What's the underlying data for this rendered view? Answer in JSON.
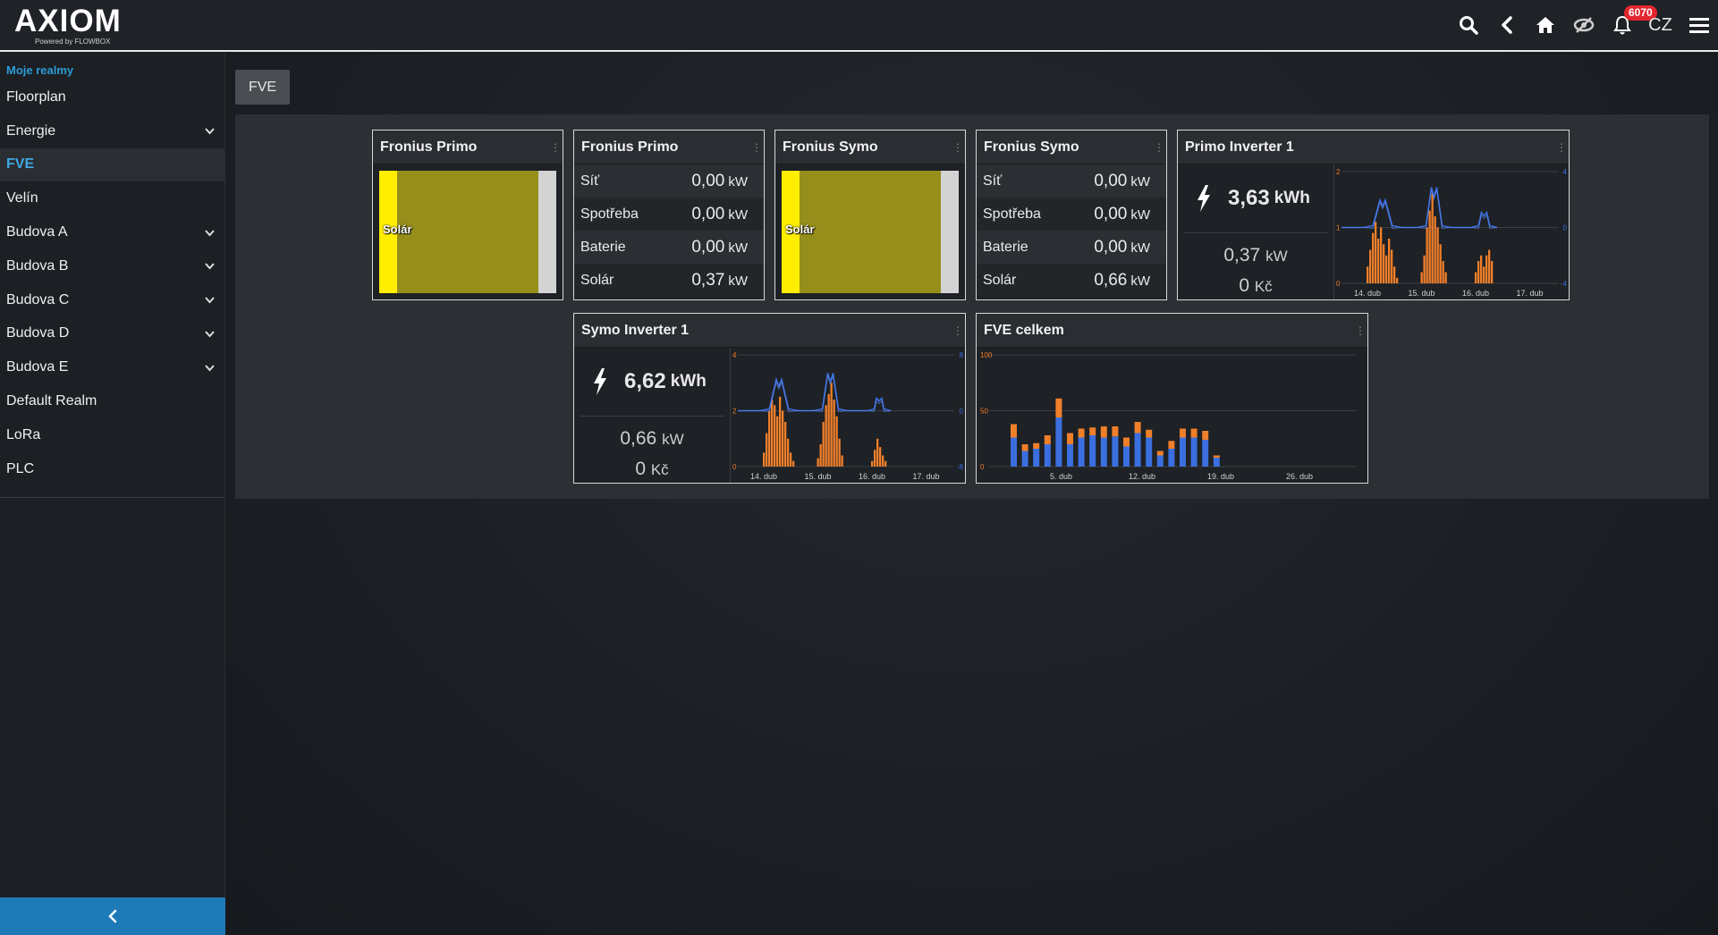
{
  "topbar": {
    "logo": "AXIOM",
    "logo_sub": "Powered by FLOWBOX",
    "notification_count": "6070",
    "language": "CZ",
    "icons": [
      "search-icon",
      "back-icon",
      "home-icon",
      "visibility-icon",
      "bell-icon",
      "menu-icon"
    ]
  },
  "sidebar": {
    "heading": "Moje realmy",
    "items": [
      {
        "label": "Floorplan",
        "expandable": false
      },
      {
        "label": "Energie",
        "expandable": true
      },
      {
        "label": "FVE",
        "expandable": false,
        "active": true
      },
      {
        "label": "Velín",
        "expandable": false
      },
      {
        "label": "Budova A",
        "expandable": true
      },
      {
        "label": "Budova B",
        "expandable": true
      },
      {
        "label": "Budova C",
        "expandable": true
      },
      {
        "label": "Budova D",
        "expandable": true
      },
      {
        "label": "Budova E",
        "expandable": true
      },
      {
        "label": "Default Realm",
        "expandable": false
      },
      {
        "label": "LoRa",
        "expandable": false
      },
      {
        "label": "PLC",
        "expandable": false
      }
    ]
  },
  "main": {
    "tab": "FVE",
    "tiles": {
      "primo_flow": {
        "title": "Fronius Primo",
        "label": "Solár"
      },
      "primo_values": {
        "title": "Fronius Primo",
        "rows": [
          {
            "label": "Síť",
            "value": "0,00",
            "unit": "kW"
          },
          {
            "label": "Spotřeba",
            "value": "0,00",
            "unit": "kW"
          },
          {
            "label": "Baterie",
            "value": "0,00",
            "unit": "kW"
          },
          {
            "label": "Solár",
            "value": "0,37",
            "unit": "kW"
          }
        ]
      },
      "symo_flow": {
        "title": "Fronius Symo",
        "label": "Solár"
      },
      "symo_values": {
        "title": "Fronius Symo",
        "rows": [
          {
            "label": "Síť",
            "value": "0,00",
            "unit": "kW"
          },
          {
            "label": "Spotřeba",
            "value": "0,00",
            "unit": "kW"
          },
          {
            "label": "Baterie",
            "value": "0,00",
            "unit": "kW"
          },
          {
            "label": "Solár",
            "value": "0,66",
            "unit": "kW"
          }
        ]
      },
      "primo_inverter": {
        "title": "Primo Inverter 1",
        "energy": "3,63",
        "energy_unit": "kWh",
        "power": "0,37",
        "power_unit": "kW",
        "cost": "0",
        "cost_unit": "Kč"
      },
      "symo_inverter": {
        "title": "Symo Inverter 1",
        "energy": "6,62",
        "energy_unit": "kWh",
        "power": "0,66",
        "power_unit": "kW",
        "cost": "0",
        "cost_unit": "Kč"
      },
      "fve_total": {
        "title": "FVE celkem"
      }
    },
    "colors": {
      "solar_bar": "#f07f2a",
      "power_line": "#3b6fe0",
      "solar_yellow": "#ffee00",
      "solar_olive": "#968e1b"
    }
  },
  "chart_data": [
    {
      "type": "bar",
      "name": "primo-inverter",
      "x_ticks": [
        "14. dub",
        "15. dub",
        "16. dub",
        "17. dub"
      ],
      "y_left_ticks": [
        "0",
        "1",
        "2"
      ],
      "y_right_ticks": [
        "-4",
        "0",
        "4"
      ],
      "ylim_left": [
        0,
        2
      ],
      "ylim_right": [
        -4,
        4
      ],
      "days": [
        {
          "bars": [
            0.3,
            0.6,
            0.9,
            1.1,
            0.8,
            1.0,
            0.7,
            0.5,
            0.8,
            0.6,
            0.3,
            0.1
          ]
        },
        {
          "bars": [
            0.2,
            0.5,
            1.0,
            1.3,
            1.6,
            1.2,
            1.0,
            0.7,
            0.4,
            0.2
          ]
        },
        {
          "bars": [
            0.2,
            0.4,
            0.5,
            0.3,
            0.5,
            0.6,
            0.4
          ]
        }
      ]
    },
    {
      "type": "bar",
      "name": "symo-inverter",
      "x_ticks": [
        "14. dub",
        "15. dub",
        "16. dub",
        "17. dub"
      ],
      "y_left_ticks": [
        "0",
        "2",
        "4"
      ],
      "y_right_ticks": [
        "-8",
        "0",
        "8"
      ],
      "ylim_left": [
        0,
        4
      ],
      "ylim_right": [
        -8,
        8
      ],
      "days": [
        {
          "bars": [
            0.5,
            1.2,
            2.0,
            2.4,
            2.2,
            1.8,
            2.5,
            2.0,
            1.6,
            1.0,
            0.5,
            0.2
          ]
        },
        {
          "bars": [
            0.3,
            0.8,
            1.6,
            2.2,
            2.6,
            3.0,
            2.4,
            1.8,
            1.0,
            0.4
          ]
        },
        {
          "bars": [
            0.2,
            0.6,
            1.0,
            0.7,
            0.4,
            0.2
          ]
        }
      ]
    },
    {
      "type": "bar",
      "name": "fve-total",
      "x_ticks": [
        "5. dub",
        "12. dub",
        "19. dub",
        "26. dub"
      ],
      "y_ticks": [
        "0",
        "50",
        "100"
      ],
      "ylim": [
        0,
        100
      ],
      "series": [
        {
          "values": [
            26,
            14,
            16,
            20,
            44,
            20,
            26,
            28,
            26,
            27,
            18,
            30,
            26,
            10,
            16,
            26,
            26,
            24,
            8
          ]
        },
        {
          "values": [
            12,
            6,
            5,
            8,
            17,
            10,
            8,
            7,
            10,
            9,
            8,
            10,
            7,
            4,
            7,
            8,
            8,
            8,
            2
          ]
        }
      ]
    }
  ]
}
